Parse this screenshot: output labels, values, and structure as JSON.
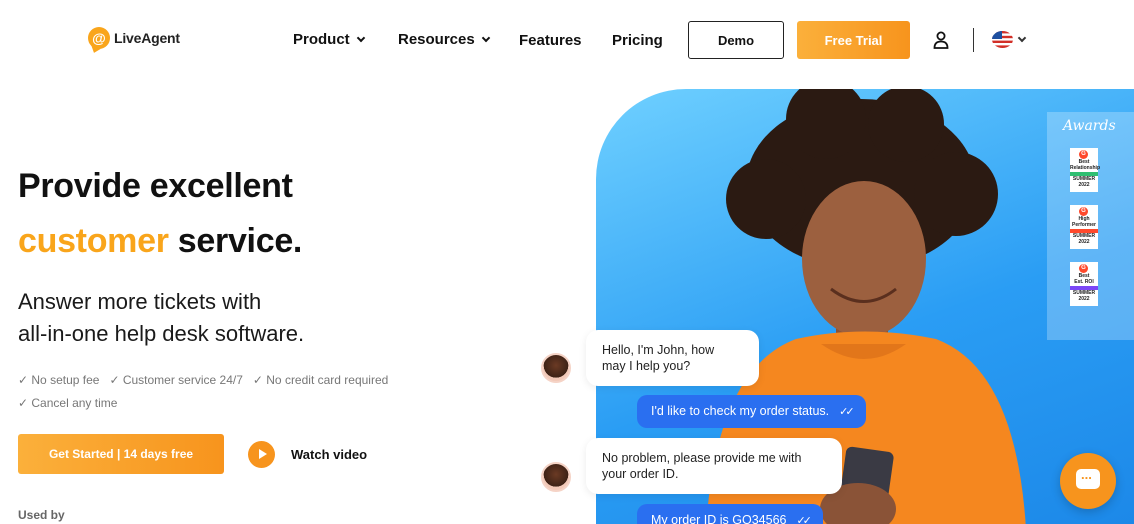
{
  "header": {
    "logo_icon": "at-sign-chat-icon",
    "logo_text": "LiveAgent",
    "nav": [
      {
        "label": "Product",
        "has_dropdown": true
      },
      {
        "label": "Resources",
        "has_dropdown": true
      },
      {
        "label": "Features",
        "has_dropdown": false
      },
      {
        "label": "Pricing",
        "has_dropdown": false
      }
    ],
    "demo_label": "Demo",
    "trial_label": "Free Trial",
    "user_icon": "user-icon",
    "language_icon": "us-flag-icon"
  },
  "hero": {
    "title_line1": "Provide excellent",
    "title_accent": "customer",
    "title_rest": " service.",
    "subtitle_line1": "Answer more tickets with",
    "subtitle_line2": "all-in-one help desk software.",
    "checks": [
      "✓ No setup fee",
      "✓ Customer service 24/7",
      "✓ No credit card required",
      "✓ Cancel any time"
    ],
    "cta_label": "Get Started | 14 days free",
    "video_label": "Watch video",
    "used_by": "Used by"
  },
  "awards": {
    "title": "Awards",
    "badges": [
      {
        "lines": [
          "Best",
          "Relationship"
        ],
        "strip_color": "#2fbf71",
        "season": "SUMMER 2022"
      },
      {
        "lines": [
          "High",
          "Performer"
        ],
        "strip_color": "#ff492c",
        "season": "SUMMER 2022"
      },
      {
        "lines": [
          "Best",
          "Est. ROI"
        ],
        "strip_color": "#7b46f6",
        "season": "SUMMER 2022"
      }
    ]
  },
  "chat": {
    "msg1_line1": "Hello, I'm John, how",
    "msg1_line2": "may I help you?",
    "reply1": "I'd like to check my order status.",
    "msg2_line1": "No problem, please provide me with",
    "msg2_line2": "your order ID.",
    "reply2": "My order ID is GO34566",
    "fab_icon": "chat-bubble-icon"
  },
  "colors": {
    "accent": "#f9a51b",
    "hero_blue": "#2a9df4",
    "reply_blue": "#2a6ff0"
  }
}
